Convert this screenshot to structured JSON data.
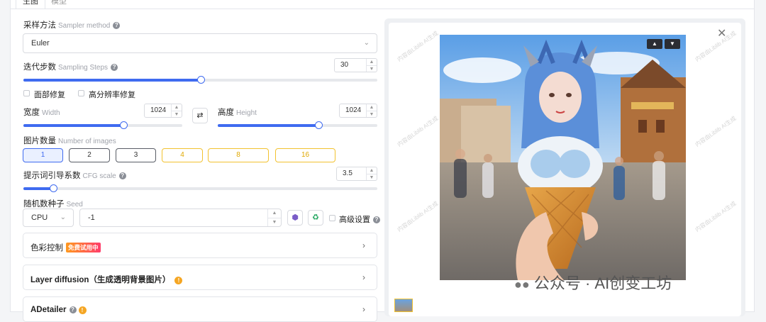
{
  "tabs": [
    {
      "label": "生图"
    },
    {
      "label": "模型"
    }
  ],
  "sampler": {
    "label": "采样方法",
    "label_en": "Sampler method",
    "value": "Euler"
  },
  "steps": {
    "label": "迭代步数",
    "label_en": "Sampling Steps",
    "value": "30",
    "fraction": 0.5
  },
  "options": {
    "face_fix": "面部修复",
    "hires_fix": "高分辨率修复"
  },
  "width": {
    "label": "宽度",
    "label_en": "Width",
    "value": "1024",
    "fraction": 0.63
  },
  "height": {
    "label": "高度",
    "label_en": "Height",
    "value": "1024",
    "fraction": 0.63
  },
  "images": {
    "label": "图片数量",
    "label_en": "Number of images",
    "buttons": [
      "1",
      "2",
      "3",
      "4",
      "8",
      "16"
    ],
    "selected": "1"
  },
  "cfg": {
    "label": "提示词引导系数",
    "label_en": "CFG scale",
    "value": "3.5",
    "fraction": 0.085
  },
  "seed": {
    "label": "随机数种子",
    "label_en": "Seed",
    "device": "CPU",
    "value": "-1",
    "advanced": "高级设置"
  },
  "panels": {
    "color_control": "色彩控制",
    "free_badge": "免费试用中",
    "layer_diffusion": "Layer diffusion（生成透明背景图片）",
    "adetailer": "ADetailer"
  },
  "watermark": {
    "corner": "公众号 · AI创变工坊",
    "tiles": [
      "内容由Liblib AI生成",
      "内容由Liblib AI生成",
      "内容由Liblib AI生成",
      "内容由Liblib AI生成",
      "内容由Liblib AI生成",
      "内容由Liblib AI生成"
    ]
  },
  "colors": {
    "accent": "#3f6bf0",
    "gold": "#f2c230",
    "warn": "#f5a623"
  }
}
